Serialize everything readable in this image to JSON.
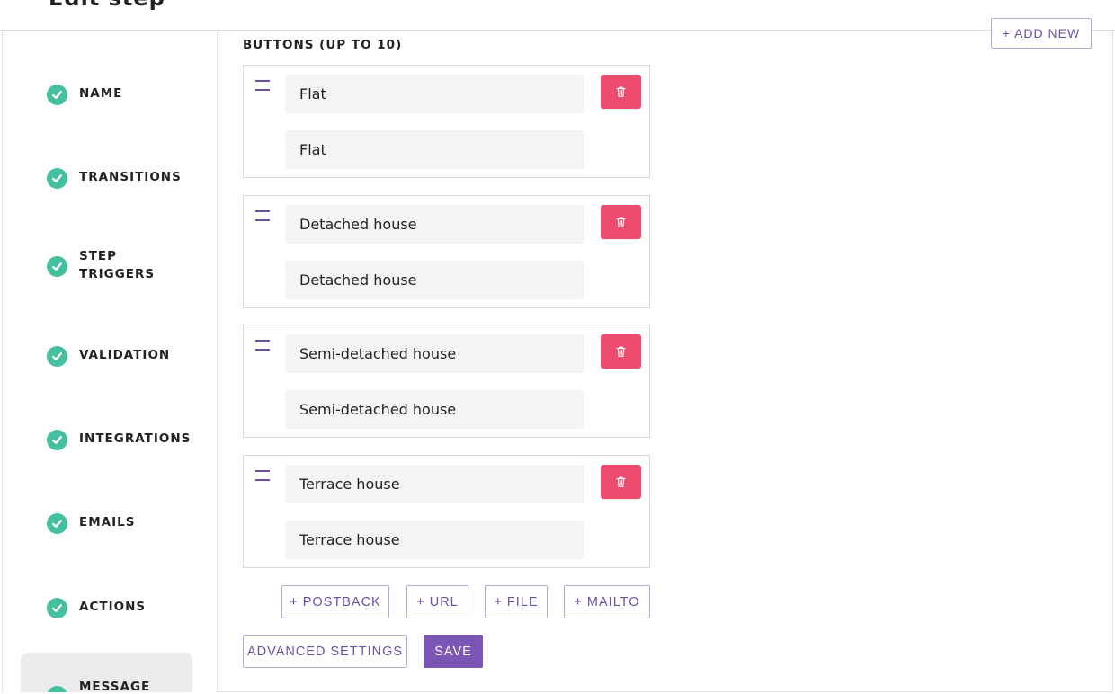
{
  "header": {
    "cut_title": "Edit step"
  },
  "sidebar": {
    "items": [
      {
        "label": "Name"
      },
      {
        "label": "Transitions"
      },
      {
        "label": "Step Triggers"
      },
      {
        "label": "Validation"
      },
      {
        "label": "Integrations"
      },
      {
        "label": "Emails"
      },
      {
        "label": "Actions"
      },
      {
        "label": "Message"
      }
    ]
  },
  "buttons_section": {
    "title": "BUTTONS (UP TO 10)",
    "add_new_label": "+ ADD NEW",
    "items": [
      {
        "label": "Flat",
        "value": "Flat"
      },
      {
        "label": "Detached house",
        "value": "Detached house"
      },
      {
        "label": "Semi-detached house",
        "value": "Semi-detached house"
      },
      {
        "label": "Terrace house",
        "value": "Terrace house"
      }
    ]
  },
  "add_buttons": {
    "postback": "+ POSTBACK",
    "url": "+ URL",
    "file": "+ FILE",
    "mailto": "+ MAILTO"
  },
  "footer": {
    "advanced_settings": "ADVANCED SETTINGS",
    "save": "SAVE"
  },
  "colors": {
    "accent": "#7b56b4",
    "check": "#44bfa0",
    "delete": "#ed4c6e"
  }
}
